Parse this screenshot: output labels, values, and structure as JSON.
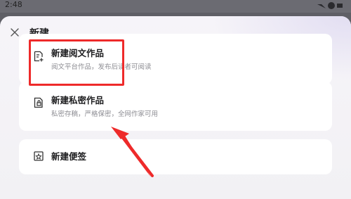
{
  "status_bar": {
    "time": "2:48"
  },
  "sheet": {
    "title": "新建",
    "options": [
      {
        "title": "新建阅文作品",
        "description": "阅文平台作品，发布后读者可阅读",
        "icon": "document-plus-icon"
      },
      {
        "title": "新建私密作品",
        "description": "私密存稿，严格保密，全网作家可用",
        "icon": "private-document-icon"
      },
      {
        "title": "新建便签",
        "icon": "note-icon"
      }
    ]
  },
  "colors": {
    "annotation": "#ee2a2a",
    "card": "#ffffff",
    "sheet": "#f3f2f5"
  }
}
